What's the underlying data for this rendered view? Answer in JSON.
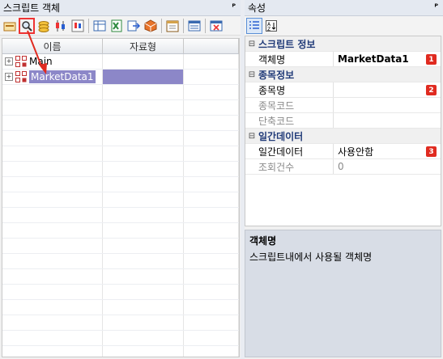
{
  "left_panel": {
    "title": "스크립트 객체",
    "pin": "ᴾ",
    "columns": [
      "이름",
      "자료형",
      ""
    ],
    "rows": [
      {
        "name": "Main",
        "type": ""
      },
      {
        "name": "MarketData1",
        "type": ""
      }
    ]
  },
  "right_panel": {
    "title": "속성",
    "pin": "ᴾ",
    "categories": [
      {
        "label": "스크립트 정보",
        "props": [
          {
            "name": "객체명",
            "value": "MarketData1",
            "badge": "1",
            "disabled": false
          }
        ]
      },
      {
        "label": "종목정보",
        "props": [
          {
            "name": "종목명",
            "value": "",
            "badge": "2",
            "disabled": false
          },
          {
            "name": "종목코드",
            "value": "",
            "badge": "",
            "disabled": true
          },
          {
            "name": "단축코드",
            "value": "",
            "badge": "",
            "disabled": true
          }
        ]
      },
      {
        "label": "일간데이터",
        "props": [
          {
            "name": "일간데이터",
            "value": "사용안함",
            "badge": "3",
            "disabled": false
          },
          {
            "name": "조회건수",
            "value": "0",
            "badge": "",
            "disabled": true
          }
        ]
      }
    ],
    "description": {
      "title": "객체명",
      "text": "스크립트내에서 사용될 객체명"
    }
  },
  "colors": {
    "accent_red": "#e02b20",
    "selection": "#8c87c8",
    "category_text": "#203a78"
  }
}
